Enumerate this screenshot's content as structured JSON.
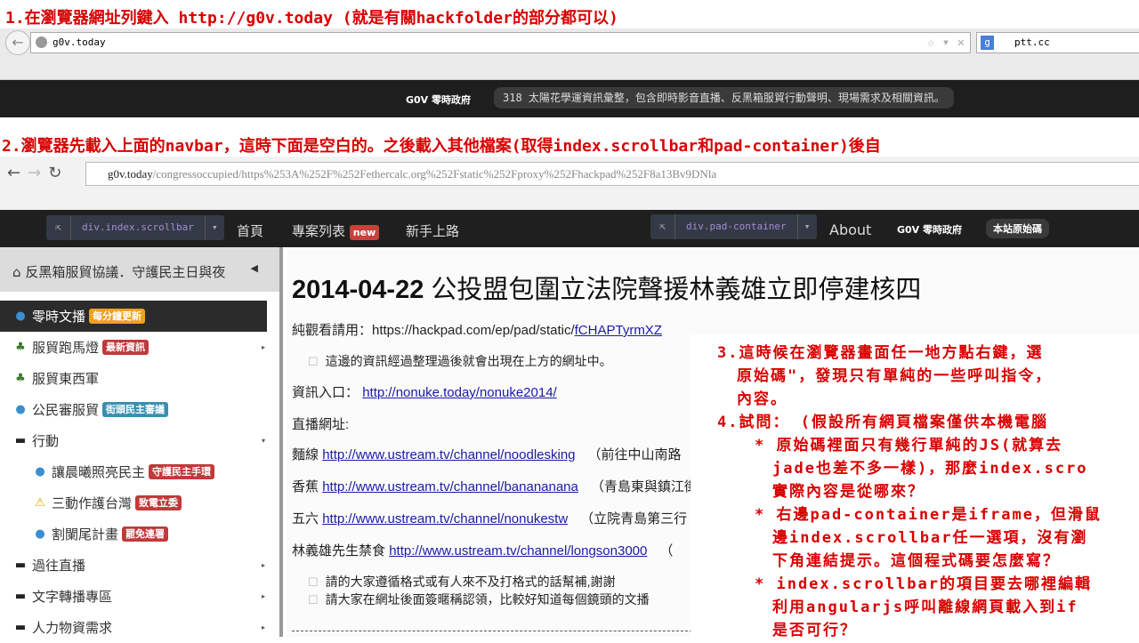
{
  "notes": {
    "n1": "1.在瀏覽器網址列鍵入 http://g0v.today (就是有關hackfolder的部分都可以)",
    "n2": "2.瀏覽器先載入上面的navbar，這時下面是空白的。之後載入其他檔案(取得index.scrollbar和pad-container)後自",
    "n3": [
      "3.這時候在瀏覽器畫面任一地方點右鍵，選",
      "原始碼\"，發現只有單純的一些呼叫指令，",
      "內容。",
      "4.試問：  (假設所有網頁檔案僅供本機電腦",
      "* 原始碼裡面只有幾行單純的JS(就算去",
      "jade也差不多一樣)，那麼index.scro",
      "實際內容是從哪來？",
      "* 右邊pad-container是iframe，但滑鼠",
      "邊index.scrollbar任一選項，沒有瀏",
      "下角連結提示。這個程式碼要怎麼寫？",
      "* index.scrollbar的項目要去哪裡編輯",
      "利用angularjs呼叫離線網頁載入到if",
      "是否可行？"
    ]
  },
  "browser1": {
    "url": "g0v.today",
    "search": "ptt.cc"
  },
  "banner": {
    "logo": "G0V 零時政府",
    "text": "318 太陽花學運資訊彙整，包含即時影音直播、反黑箱服貿行動聲明、現場需求及相關資訊。"
  },
  "browser2": {
    "url_host": "g0v.today",
    "url_path": "/congressoccupied/https%253A%252F%252Fethercalc.org%252Fstatic%252Fproxy%252Fhackpad%252F8a13Bv9DNla"
  },
  "nav": {
    "inspect1": "div.index.scrollbar",
    "home": "首頁",
    "projects": "專案列表",
    "new_badge": "new",
    "beginner": "新手上路",
    "inspect2": "div.pad-container",
    "about": "About",
    "logo": "G0V 零時政府",
    "source": "本站原始碼"
  },
  "sidebar": {
    "header": "反黑箱服貿協議．守護民主日與夜",
    "items": [
      {
        "label": "零時文播",
        "badge": "每分鐘更新",
        "badge_color": "#f0a020"
      },
      {
        "label": "服貿跑馬燈",
        "badge": "最新資訊",
        "badge_color": "#c0393b"
      },
      {
        "label": "服貿東西軍"
      },
      {
        "label": "公民審服貿",
        "badge": "街頭民主審議",
        "badge_color": "#3a8fb0"
      },
      {
        "label": "行動"
      },
      {
        "label": "讓晨曦照亮民主",
        "badge": "守護民主手環",
        "badge_color": "#c0393b"
      },
      {
        "label": "三動作護台灣",
        "badge": "致電立委",
        "badge_color": "#c0393b"
      },
      {
        "label": "割闌尾計畫",
        "badge": "罷免連署",
        "badge_color": "#c0393b"
      },
      {
        "label": "過往直播"
      },
      {
        "label": "文字轉播專區"
      },
      {
        "label": "人力物資需求"
      }
    ]
  },
  "pad": {
    "date": "2014-04-22",
    "title": "公投盟包圍立法院聲援林義雄立即停建核四",
    "view_prefix": "純觀看請用：https://hackpad.com/ep/pad/static/",
    "view_link": "fCHAPTyrmXZ",
    "c1": "這邊的資訊經過整理過後就會出現在上方的網址中。",
    "entry_label": "資訊入口：",
    "entry_link": "http://nonuke.today/nonuke2014/",
    "live_label": "直播網址:",
    "streams": [
      {
        "name": "麵線",
        "url": "http://www.ustream.tv/channel/noodlesking",
        "note": "（前往中山南路"
      },
      {
        "name": "香蕉",
        "url": "http://www.ustream.tv/channel/banananana",
        "note": "（青島東與鎮江街"
      },
      {
        "name": "五六",
        "url": "http://www.ustream.tv/channel/nonukestw",
        "note": "（立院青島第三行"
      },
      {
        "name": "林義雄先生禁食",
        "url": "http://www.ustream.tv/channel/longson3000",
        "note": "（"
      }
    ],
    "c2": "請的大家遵循格式或有人來不及打格式的話幫補,謝謝",
    "c3": "請大家在網址後面簽暱稱認領，比較好知道每個鏡頭的文播"
  }
}
